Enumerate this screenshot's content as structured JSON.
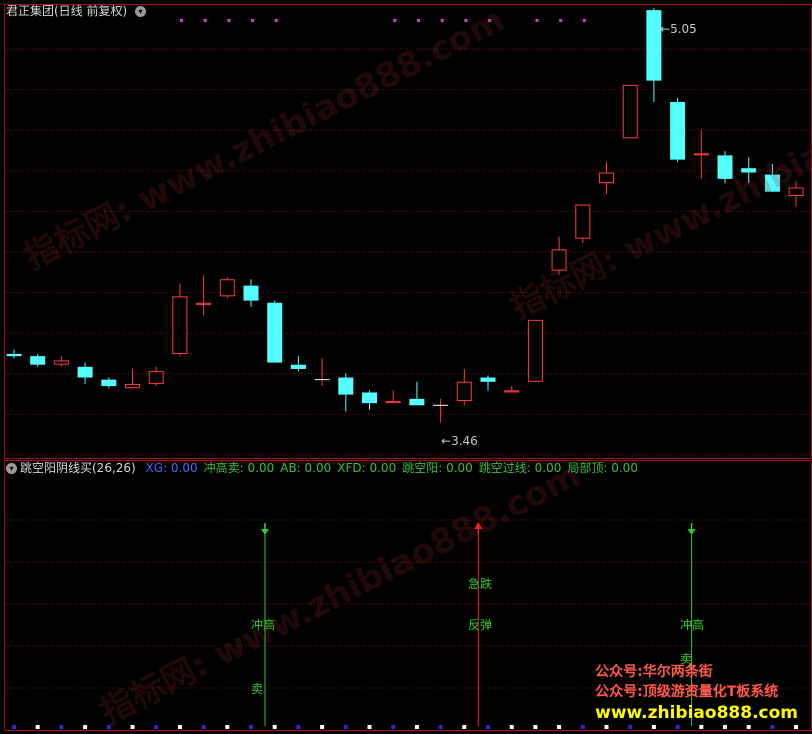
{
  "header": {
    "stock_title": "君正集团(日线 前复权)",
    "menu_icon": "chevron-down-icon"
  },
  "price": {
    "high_label": "5.05",
    "low_label": "3.46"
  },
  "indicator": {
    "name": "跳空阳阴线买(26,26)",
    "params": [
      {
        "label": "XG: 0.00",
        "color": "#3f6bff"
      },
      {
        "label": "冲高卖: 0.00",
        "color": "#3fbf3f"
      },
      {
        "label": "AB: 0.00",
        "color": "#3fbf3f"
      },
      {
        "label": "XFD: 0.00",
        "color": "#3fbf3f"
      },
      {
        "label": "跳空阳: 0.00",
        "color": "#3fbf3f"
      },
      {
        "label": "跳空过线: 0.00",
        "color": "#3fbf3f"
      },
      {
        "label": "局部顶: 0.00",
        "color": "#3fbf3f"
      }
    ],
    "signals": [
      {
        "dir": "down",
        "color": "#2ecc2e",
        "lines": [
          "冲高",
          "卖"
        ]
      },
      {
        "dir": "up",
        "color": "#ff2020",
        "lines": [
          "急跌",
          "反弹"
        ]
      },
      {
        "dir": "down",
        "color": "#2ecc2e",
        "lines": [
          "冲高",
          "卖"
        ]
      }
    ]
  },
  "watermark": {
    "text": "指标网: www.zhibiao888.com"
  },
  "promo": {
    "line1": "公众号:华尔两条街",
    "line2": "公众号:顶级游资量化T板系统",
    "line3": "www.zhibiao888.com"
  },
  "colors": {
    "up_candle": "#ff3a3a",
    "down_candle": "#54ffff",
    "panel_border": "#a01010",
    "grid": "#7a1010"
  },
  "chart_data": {
    "type": "candlestick",
    "candles": [
      {
        "o": 3.78,
        "c": 3.77,
        "h": 3.8,
        "l": 3.76
      },
      {
        "o": 3.77,
        "c": 3.73,
        "h": 3.78,
        "l": 3.72
      },
      {
        "o": 3.73,
        "c": 3.75,
        "h": 3.77,
        "l": 3.72
      },
      {
        "o": 3.72,
        "c": 3.67,
        "h": 3.74,
        "l": 3.64
      },
      {
        "o": 3.66,
        "c": 3.63,
        "h": 3.67,
        "l": 3.62
      },
      {
        "o": 3.62,
        "c": 3.64,
        "h": 3.71,
        "l": 3.62
      },
      {
        "o": 3.64,
        "c": 3.7,
        "h": 3.72,
        "l": 3.63
      },
      {
        "o": 3.78,
        "c": 4.05,
        "h": 4.11,
        "l": 3.77
      },
      {
        "o": 4.01,
        "c": 4.02,
        "h": 4.15,
        "l": 3.96
      },
      {
        "o": 4.05,
        "c": 4.13,
        "h": 4.14,
        "l": 4.04
      },
      {
        "o": 4.1,
        "c": 4.03,
        "h": 4.13,
        "l": 4.0
      },
      {
        "o": 4.02,
        "c": 3.74,
        "h": 4.03,
        "l": 3.74
      },
      {
        "o": 3.73,
        "c": 3.71,
        "h": 3.77,
        "l": 3.7
      },
      {
        "o": 3.66,
        "c": 3.66,
        "h": 3.76,
        "l": 3.63
      },
      {
        "o": 3.67,
        "c": 3.59,
        "h": 3.69,
        "l": 3.51
      },
      {
        "o": 3.6,
        "c": 3.55,
        "h": 3.61,
        "l": 3.52
      },
      {
        "o": 3.55,
        "c": 3.56,
        "h": 3.61,
        "l": 3.55
      },
      {
        "o": 3.57,
        "c": 3.54,
        "h": 3.65,
        "l": 3.54
      },
      {
        "o": 3.54,
        "c": 3.54,
        "h": 3.57,
        "l": 3.46
      },
      {
        "o": 3.56,
        "c": 3.65,
        "h": 3.71,
        "l": 3.54
      },
      {
        "o": 3.67,
        "c": 3.65,
        "h": 3.68,
        "l": 3.61
      },
      {
        "o": 3.6,
        "c": 3.61,
        "h": 3.63,
        "l": 3.6
      },
      {
        "o": 3.65,
        "c": 3.94,
        "h": 3.94,
        "l": 3.65
      },
      {
        "o": 4.17,
        "c": 4.27,
        "h": 4.33,
        "l": 4.15
      },
      {
        "o": 4.32,
        "c": 4.48,
        "h": 4.48,
        "l": 4.3
      },
      {
        "o": 4.58,
        "c": 4.63,
        "h": 4.68,
        "l": 4.53
      },
      {
        "o": 4.79,
        "c": 5.04,
        "h": 5.04,
        "l": 4.79
      },
      {
        "o": 5.39,
        "c": 5.06,
        "h": 5.4,
        "l": 4.96
      },
      {
        "o": 4.96,
        "c": 4.69,
        "h": 4.98,
        "l": 4.68
      },
      {
        "o": 4.71,
        "c": 4.72,
        "h": 4.83,
        "l": 4.6
      },
      {
        "o": 4.71,
        "c": 4.6,
        "h": 4.73,
        "l": 4.58
      },
      {
        "o": 4.65,
        "c": 4.63,
        "h": 4.7,
        "l": 4.58
      },
      {
        "o": 4.62,
        "c": 4.54,
        "h": 4.67,
        "l": 4.54
      },
      {
        "o": 4.52,
        "c": 4.56,
        "h": 4.59,
        "l": 4.47
      }
    ],
    "signal_candle_index": [
      10,
      19,
      28
    ],
    "ylim": [
      3.34,
      5.4
    ]
  }
}
